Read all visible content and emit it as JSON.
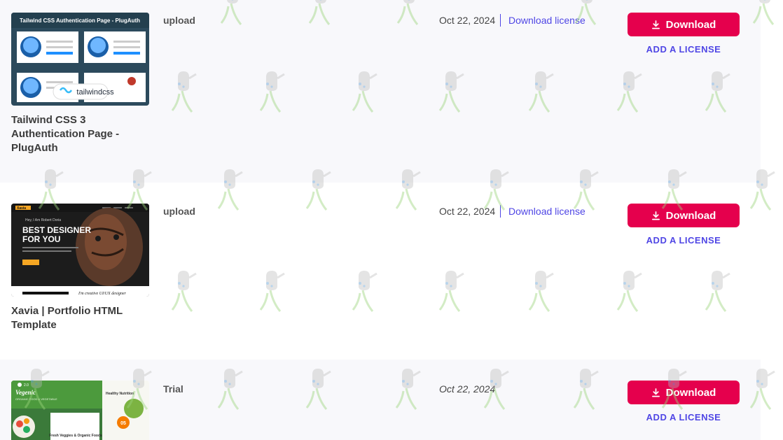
{
  "items": [
    {
      "title": "Tailwind CSS 3 Authentication Page - PlugAuth",
      "type": "upload",
      "date": "Oct 22, 2024",
      "license_link": "Download license",
      "download_label": "Download",
      "add_license_label": "ADD A LICENSE",
      "thumb": {
        "banner": "Tailwind CSS Authentication Page - PlugAuth",
        "brand": "tailwindcss",
        "bg": "#2c4a5c"
      }
    },
    {
      "title": "Xavia | Portfolio HTML Template",
      "type": "upload",
      "date": "Oct 22, 2024",
      "license_link": "Download license",
      "download_label": "Download",
      "add_license_label": "ADD A LICENSE",
      "thumb": {
        "logo": "Xavia",
        "greeting": "Hey, I Am Robert Doria",
        "headline_1": "BEST DESIGNER",
        "headline_2": "FOR YOU",
        "footer_text": "I'm creative UI/UX designer",
        "bg": "#1c1c1c"
      }
    },
    {
      "title": "",
      "type": "Trial",
      "date": "Oct 22, 2024",
      "license_link": "",
      "download_label": "Download",
      "add_license_label": "ADD A LICENSE",
      "thumb": {
        "brand": "Vegenic",
        "version": "2.0",
        "tagline": "ORGANIC FOOD & VEGETABLE",
        "card_title": "Healthy Nutrition",
        "promo": "Fresh Veggies & Organic Foods",
        "badge": "05"
      }
    }
  ],
  "colors": {
    "accent": "#e5004d",
    "link": "#4f46e5",
    "row_shade": "#f8f8fb"
  },
  "icons": {
    "download": "download-icon",
    "watermark": "watering-can-icon"
  }
}
